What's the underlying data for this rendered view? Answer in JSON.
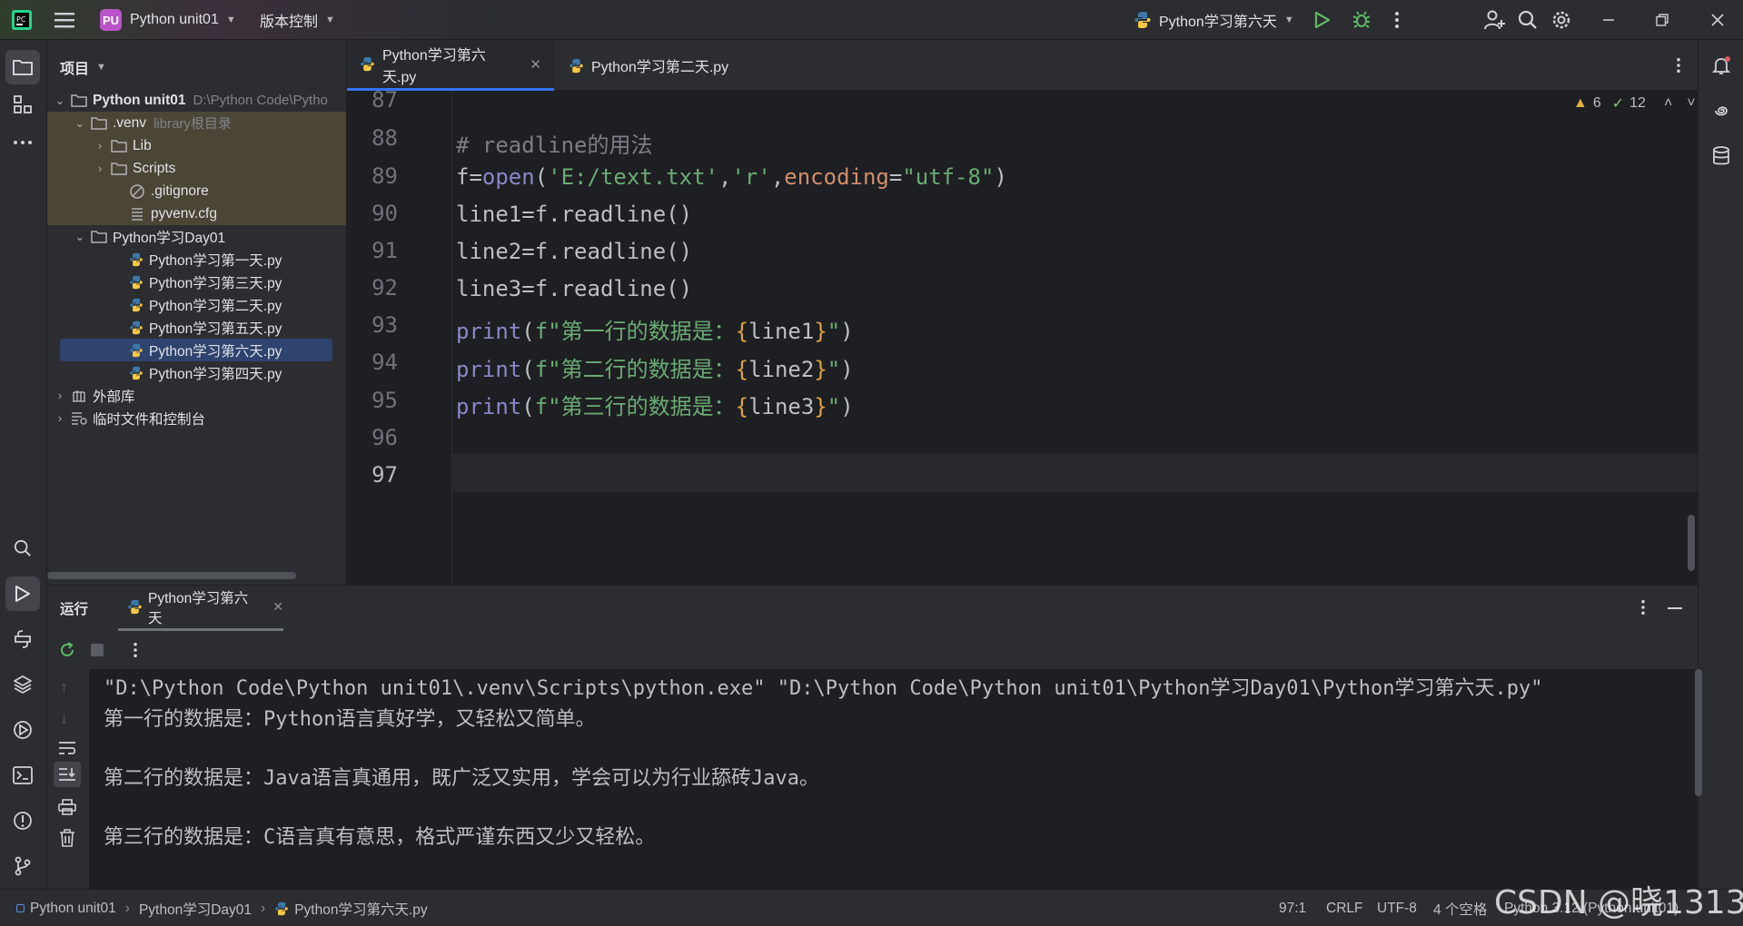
{
  "titlebar": {
    "project_badge": "PU",
    "project_name": "Python unit01",
    "vcs_menu": "版本控制",
    "run_config": "Python学习第六天",
    "badge_color": "#b954c8"
  },
  "project_panel": {
    "title": "项目",
    "tree": [
      {
        "label": "Python unit01",
        "sub": "D:\\Python Code\\Pytho"
      },
      {
        "label": ".venv",
        "sub": "library根目录"
      },
      {
        "label": "Lib"
      },
      {
        "label": "Scripts"
      },
      {
        "label": ".gitignore"
      },
      {
        "label": "pyvenv.cfg"
      },
      {
        "label": "Python学习Day01"
      },
      {
        "label": "Python学习第一天.py"
      },
      {
        "label": "Python学习第三天.py"
      },
      {
        "label": "Python学习第二天.py"
      },
      {
        "label": "Python学习第五天.py"
      },
      {
        "label": "Python学习第六天.py"
      },
      {
        "label": "Python学习第四天.py"
      },
      {
        "label": "外部库"
      },
      {
        "label": "临时文件和控制台"
      }
    ]
  },
  "editor": {
    "tabs": [
      {
        "label": "Python学习第六天.py",
        "active": true
      },
      {
        "label": "Python学习第二天.py",
        "active": false
      }
    ],
    "warnings": "6",
    "weak_warnings": "12",
    "line_numbers": [
      "87",
      "88",
      "89",
      "90",
      "91",
      "92",
      "93",
      "94",
      "95",
      "96",
      "97"
    ],
    "code": {
      "l89": "# readline的用法",
      "l90_var": "f",
      "l90_eq": "=",
      "l90_fn": "open",
      "l90_p1": "(",
      "l90_s1": "'E:/text.txt'",
      "l90_c1": ",",
      "l90_s2": "'r'",
      "l90_c2": ",",
      "l90_kw": "encoding",
      "l90_eq2": "=",
      "l90_s3": "\"utf-8\"",
      "l90_p2": ")",
      "l91": "line1=f.readline()",
      "l92": "line2=f.readline()",
      "l93": "line3=f.readline()",
      "print_fn": "print",
      "l94_a": "(",
      "l94_s": "f\"第一行的数据是：",
      "l94_b1": "{",
      "l94_v": "line1",
      "l94_b2": "}",
      "l94_e": "\"",
      "l94_c": ")",
      "l95_s": "f\"第二行的数据是：",
      "l95_v": "line2",
      "l96_s": "f\"第三行的数据是：",
      "l96_v": "line3"
    }
  },
  "run_panel": {
    "title": "运行",
    "tab_label": "Python学习第六天",
    "output": [
      "\"D:\\Python Code\\Python unit01\\.venv\\Scripts\\python.exe\" \"D:\\Python Code\\Python unit01\\Python学习Day01\\Python学习第六天.py\"",
      "第一行的数据是：Python语言真好学，又轻松又简单。",
      "",
      "第二行的数据是：Java语言真通用，既广泛又实用，学会可以为行业舔砖Java。",
      "",
      "第三行的数据是：C语言真有意思，格式严谨东西又少又轻松。"
    ]
  },
  "statusbar": {
    "crumb1": "Python unit01",
    "crumb2": "Python学习Day01",
    "crumb3": "Python学习第六天.py",
    "position": "97:1",
    "line_sep": "CRLF",
    "encoding": "UTF-8",
    "indent": "4 个空格",
    "interpreter": "Python 3.12 (Python unit01)"
  },
  "watermark": "CSDN @晓1313"
}
